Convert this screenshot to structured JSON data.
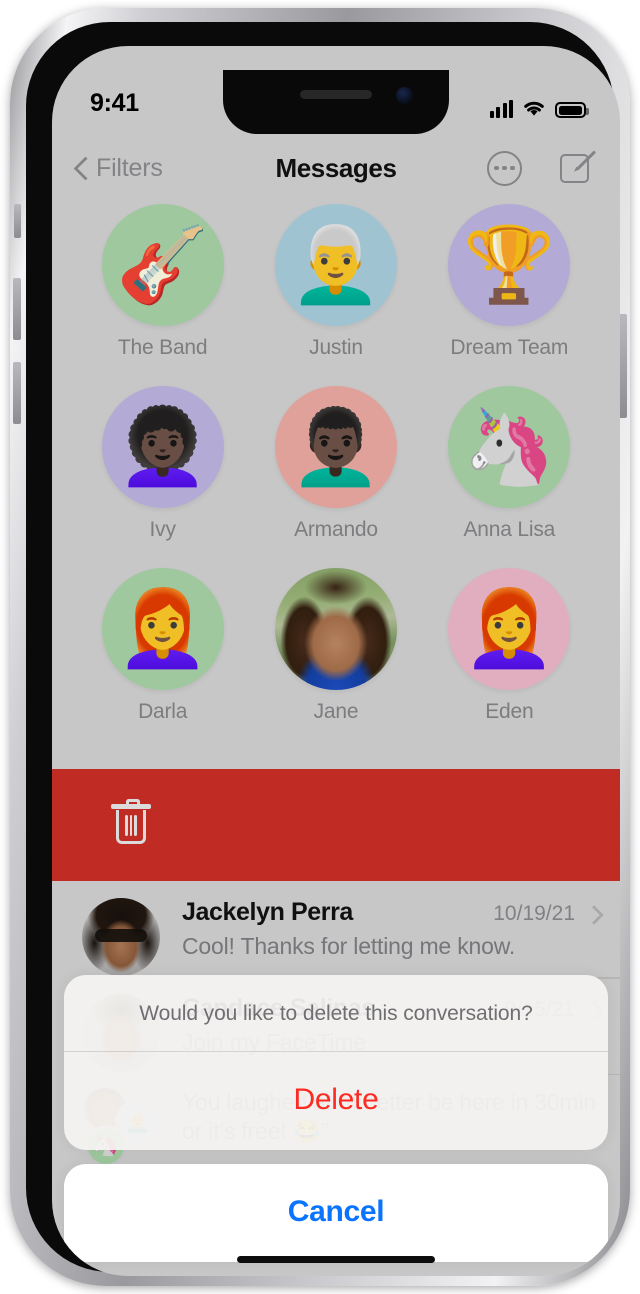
{
  "device": {
    "name": "iPhone"
  },
  "status_bar": {
    "time": "9:41",
    "signal_icon": "cellular-signal-icon",
    "wifi_icon": "wifi-icon",
    "battery_icon": "battery-icon"
  },
  "nav": {
    "back_label": "Filters",
    "back_icon": "chevron-left-icon",
    "title": "Messages",
    "more_icon": "ellipsis-circle-icon",
    "compose_icon": "compose-icon"
  },
  "pinned": {
    "rows": [
      [
        {
          "label": "The Band",
          "emoji": "🎸",
          "bg": "#a9d5a8"
        },
        {
          "label": "Justin",
          "emoji": "👨‍🦳",
          "bg": "#abd0e0"
        },
        {
          "label": "Dream Team",
          "emoji": "🏆",
          "bg": "#bfb5e3"
        }
      ],
      [
        {
          "label": "Ivy",
          "emoji": "👩🏿‍🦱",
          "bg": "#bfb5e3"
        },
        {
          "label": "Armando",
          "emoji": "👨🏿‍🦱",
          "bg": "#eeaca5"
        },
        {
          "label": "Anna Lisa",
          "emoji": "🦄",
          "bg": "#a9d5a8"
        }
      ],
      [
        {
          "label": "Darla",
          "emoji": "👩‍🦰",
          "bg": "#a9d5a8"
        },
        {
          "label": "Jane",
          "emoji": "",
          "bg": "#9fb97d",
          "photo": true
        },
        {
          "label": "Eden",
          "emoji": "👩‍🦰",
          "bg": "#efb9ca"
        }
      ]
    ]
  },
  "swipe_action": {
    "color": "#cc2f26",
    "trash_icon": "trash-icon"
  },
  "conversations": [
    {
      "name": "Jackelyn Perra",
      "date": "10/19/21",
      "preview": "Cool! Thanks for letting me know.",
      "avatar_type": "photo",
      "chevron_icon": "chevron-right-icon"
    },
    {
      "name": "Candace Salinas",
      "date": "9/15/21",
      "preview": "Join my FaceTime",
      "avatar_type": "photo",
      "chevron_icon": "chevron-right-icon"
    },
    {
      "name": "",
      "date": "",
      "preview": "You laughed at “It better be here in 30min or it’s free! 😂”",
      "avatar_type": "group",
      "group_emojis": [
        "👩",
        "👨‍🦳",
        "🦄"
      ],
      "chevron_icon": "chevron-right-icon"
    }
  ],
  "action_sheet": {
    "title": "Would you like to delete this conversation?",
    "delete_label": "Delete",
    "delete_color": "#fc2a20",
    "cancel_label": "Cancel",
    "cancel_color": "#0a74ff"
  }
}
